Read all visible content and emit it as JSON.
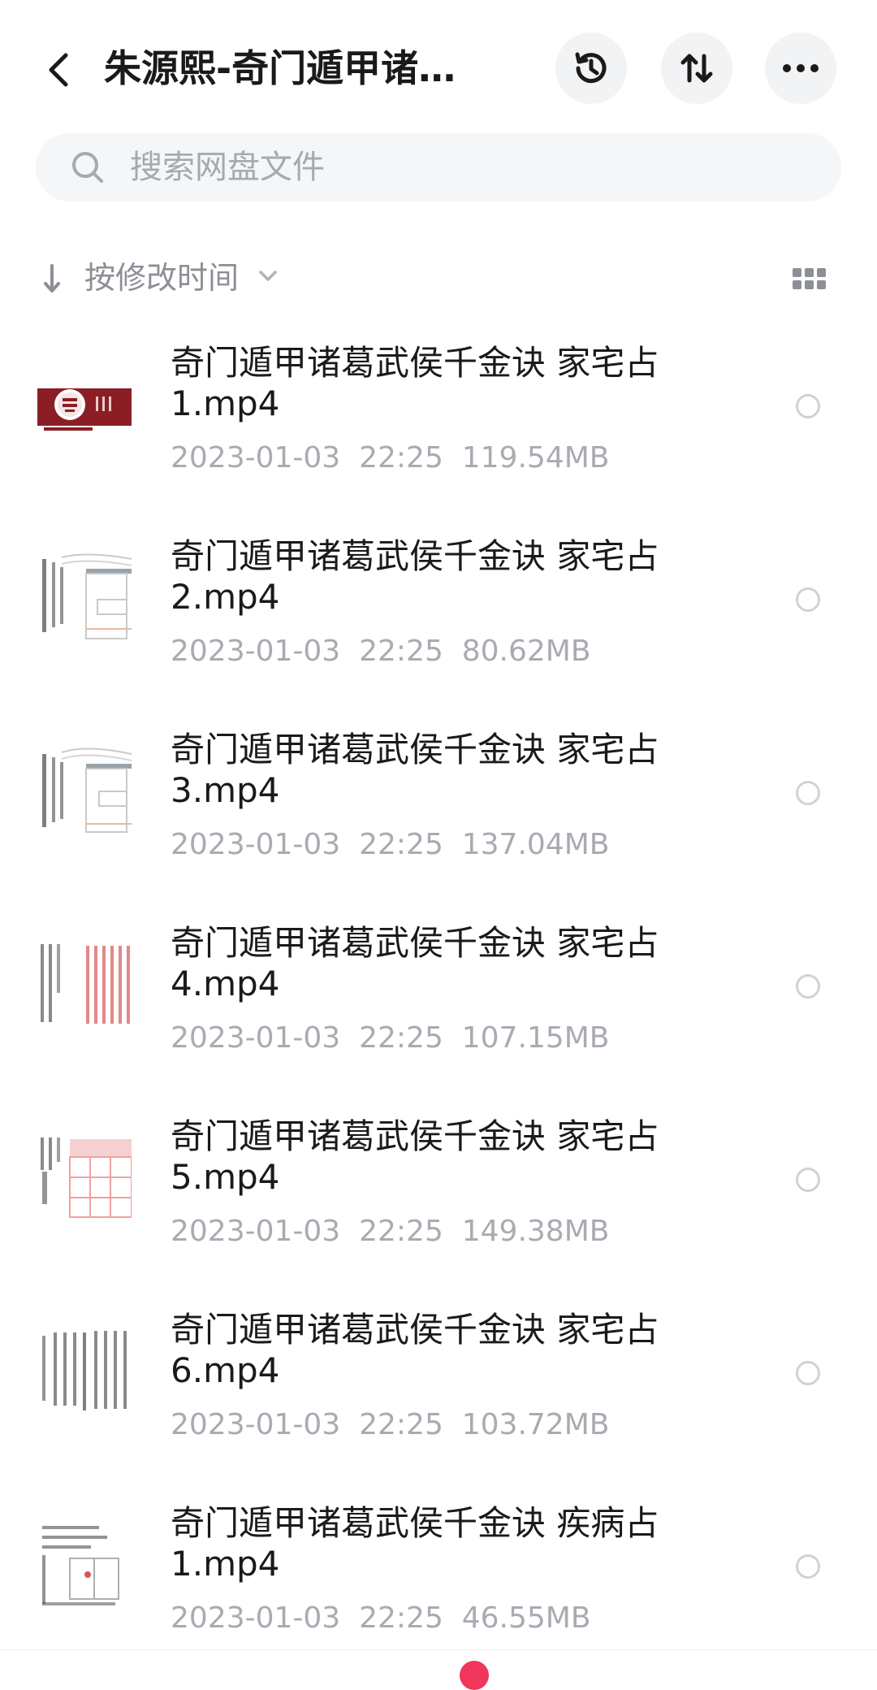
{
  "header": {
    "title": "朱源熙-奇门遁甲诸…",
    "back_icon": "chevron-left-icon",
    "history_icon": "history-clock-icon",
    "sort_icon": "sort-updown-icon",
    "more_icon": "more-dots-icon"
  },
  "search": {
    "placeholder": "搜索网盘文件",
    "icon": "search-icon"
  },
  "sortbar": {
    "label": "按修改时间",
    "arrow_icon": "arrow-down-icon",
    "chevron_icon": "chevron-down-icon",
    "view_icon": "grid-view-icon"
  },
  "files": [
    {
      "name": "奇门遁甲诸葛武侯千金诀 家宅占1.mp4",
      "meta": "2023-01-03  22:25  119.54MB"
    },
    {
      "name": "奇门遁甲诸葛武侯千金诀 家宅占2.mp4",
      "meta": "2023-01-03  22:25  80.62MB"
    },
    {
      "name": "奇门遁甲诸葛武侯千金诀 家宅占3.mp4",
      "meta": "2023-01-03  22:25  137.04MB"
    },
    {
      "name": "奇门遁甲诸葛武侯千金诀 家宅占4.mp4",
      "meta": "2023-01-03  22:25  107.15MB"
    },
    {
      "name": "奇门遁甲诸葛武侯千金诀 家宅占5.mp4",
      "meta": "2023-01-03  22:25  149.38MB"
    },
    {
      "name": "奇门遁甲诸葛武侯千金诀 家宅占6.mp4",
      "meta": "2023-01-03  22:25  103.72MB"
    },
    {
      "name": "奇门遁甲诸葛武侯千金诀 疾病占1.mp4",
      "meta": "2023-01-03  22:25  46.55MB"
    }
  ],
  "colors": {
    "accent": "#f0365a",
    "thumb_brand": "#8b1e24"
  }
}
